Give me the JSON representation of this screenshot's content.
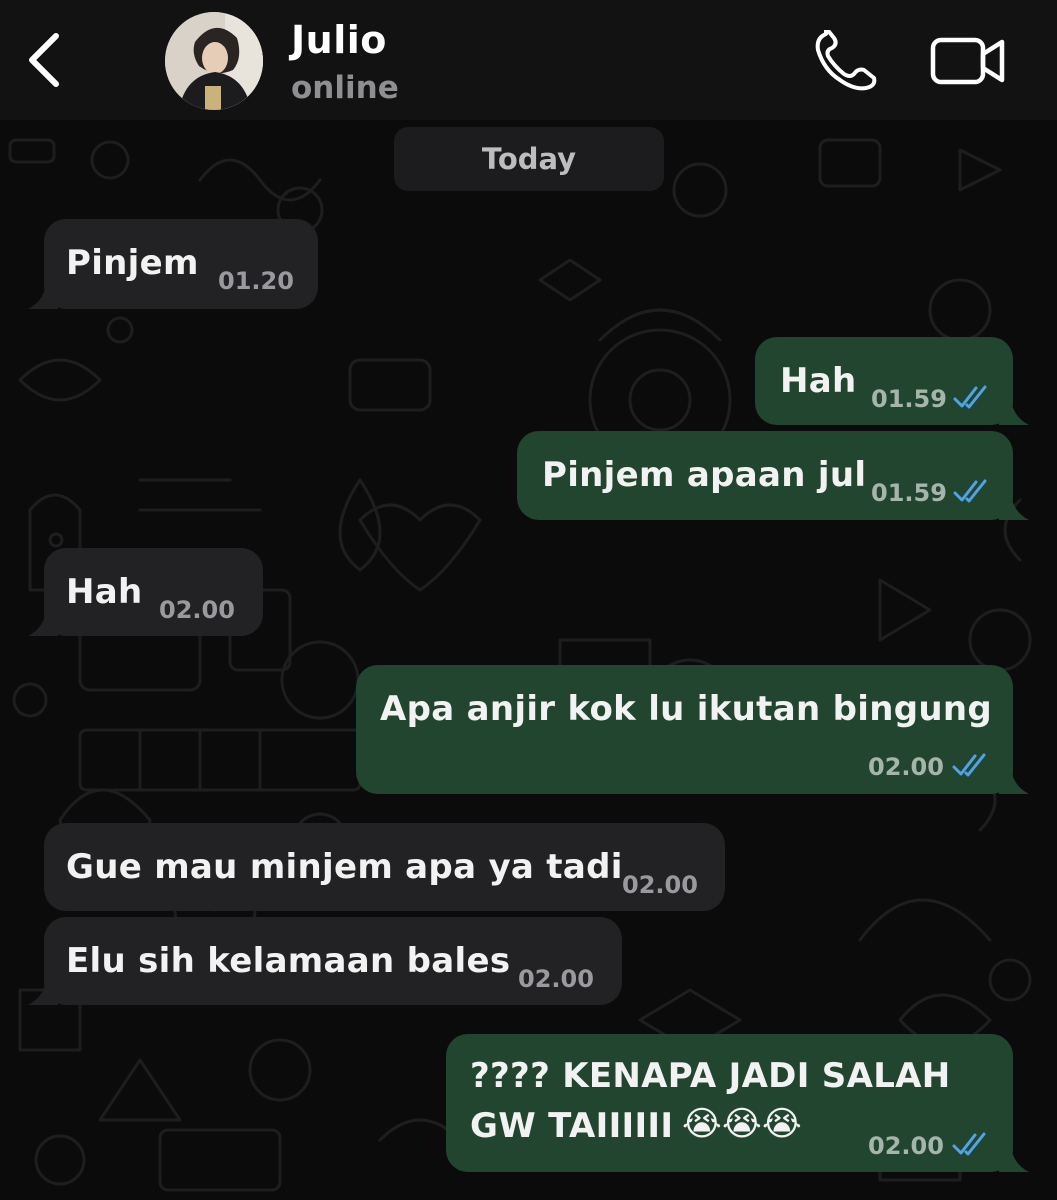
{
  "header": {
    "contact_name": "Julio",
    "contact_status": "online"
  },
  "date_chip": "Today",
  "messages": [
    {
      "direction": "incoming",
      "text": "Pinjem",
      "time": "01.20"
    },
    {
      "direction": "outgoing",
      "text": "Hah",
      "time": "01.59",
      "status": "read"
    },
    {
      "direction": "outgoing",
      "text": "Pinjem apaan jul",
      "time": "01.59",
      "status": "read"
    },
    {
      "direction": "incoming",
      "text": "Hah",
      "time": "02.00"
    },
    {
      "direction": "outgoing",
      "text": "Apa anjir kok lu ikutan bingung",
      "time": "02.00",
      "status": "read"
    },
    {
      "direction": "incoming",
      "text": "Gue mau minjem apa ya tadi",
      "time": "02.00"
    },
    {
      "direction": "incoming",
      "text": "Elu sih kelamaan bales",
      "time": "02.00"
    },
    {
      "direction": "outgoing",
      "text_line1": "???? KENAPA JADI SALAH",
      "text_line2": "GW TAIIIIII",
      "emojis": "😭😭😭",
      "time": "02.00",
      "status": "read"
    }
  ],
  "colors": {
    "background": "#0b0b0b",
    "header": "#121212",
    "incoming_bubble": "#222224",
    "outgoing_bubble": "#22452f",
    "read_ticks": "#4fa3e6"
  },
  "icons": [
    "back-chevron-icon",
    "phone-icon",
    "video-camera-icon",
    "double-check-icon"
  ]
}
